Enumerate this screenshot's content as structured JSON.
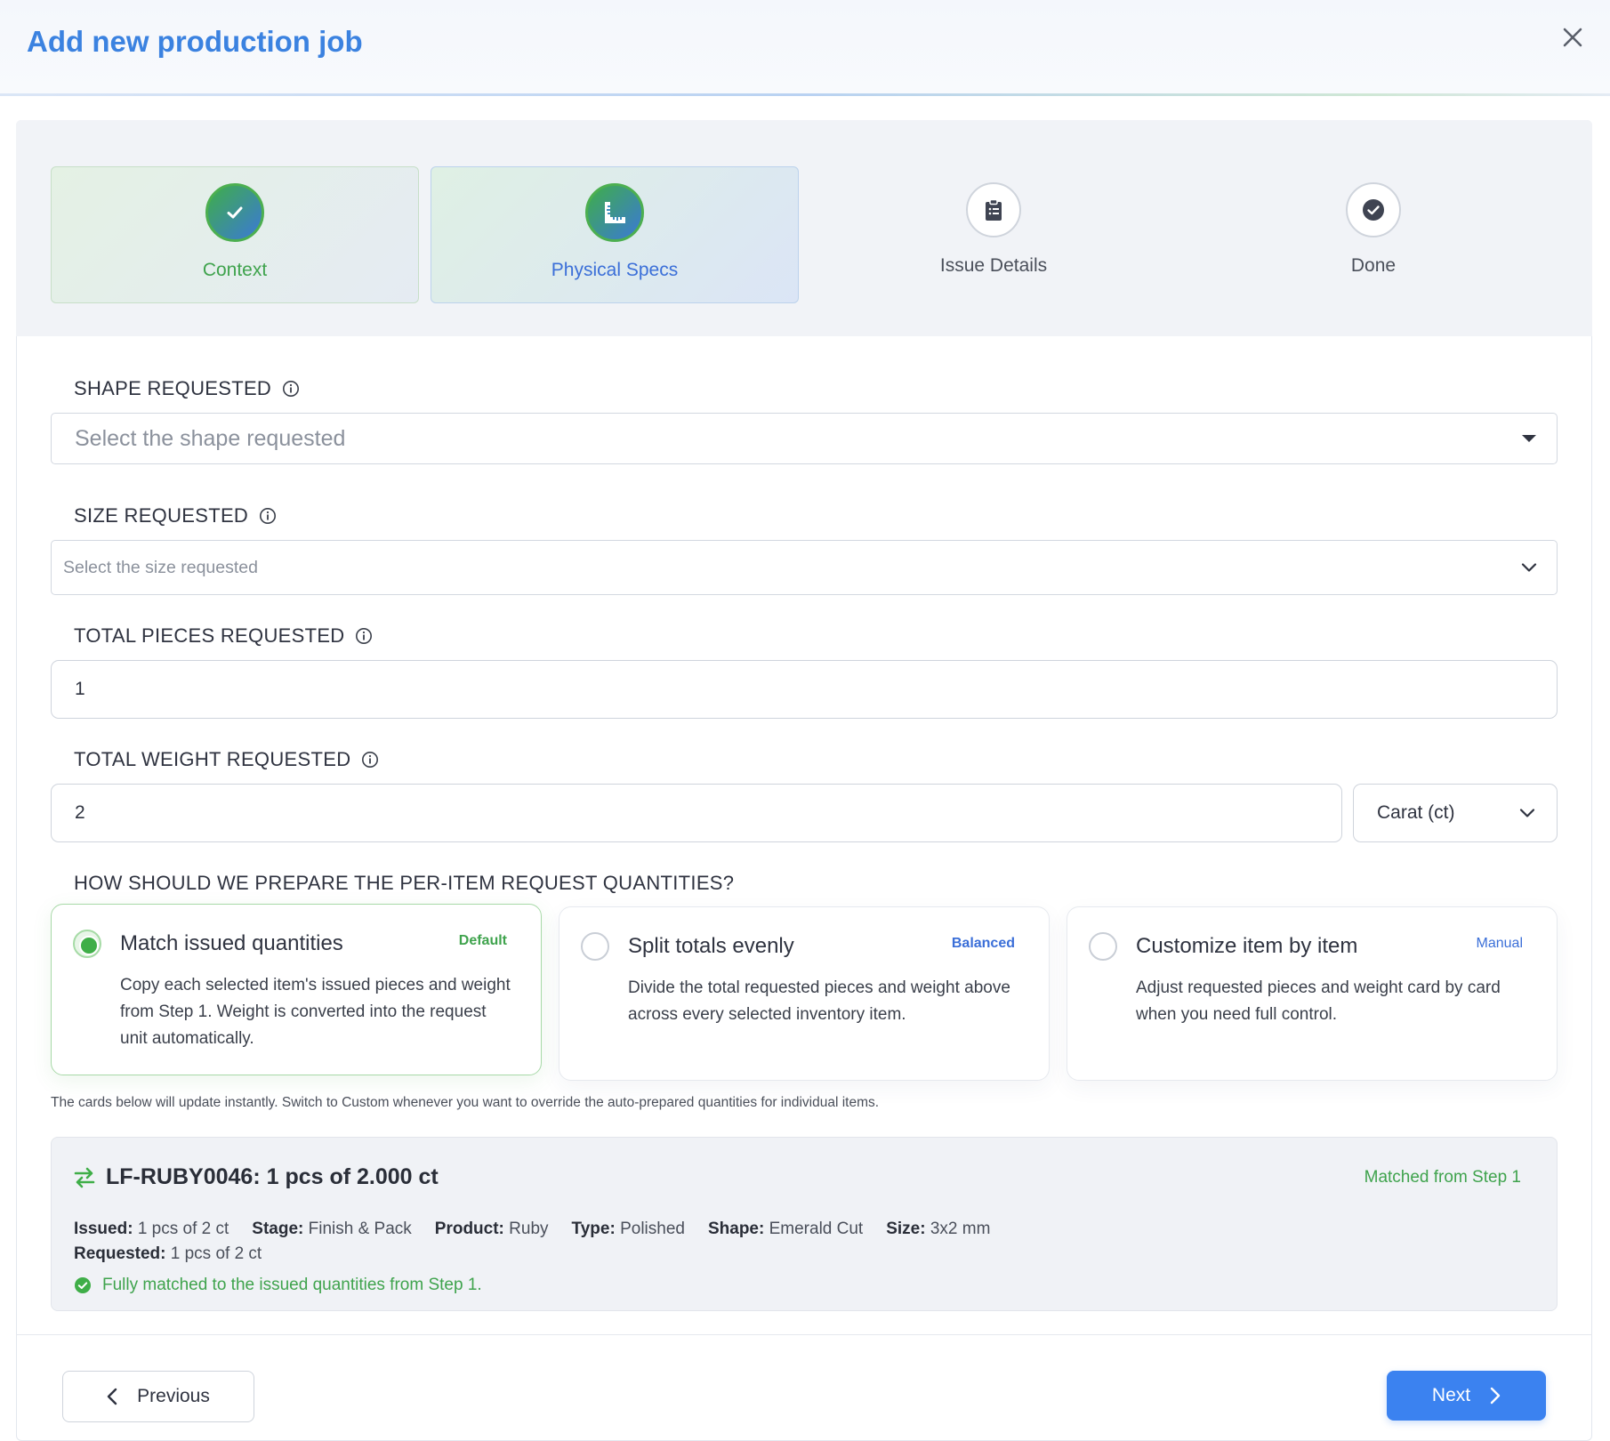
{
  "header": {
    "title": "Add new production job"
  },
  "steps": [
    {
      "label": "Context",
      "state": "completed",
      "icon": "check-icon"
    },
    {
      "label": "Physical Specs",
      "state": "active",
      "icon": "ruler-icon"
    },
    {
      "label": "Issue Details",
      "state": "pending",
      "icon": "clipboard-icon"
    },
    {
      "label": "Done",
      "state": "pending",
      "icon": "check-circle-icon"
    }
  ],
  "shape": {
    "label": "SHAPE REQUESTED",
    "placeholder": "Select the shape requested"
  },
  "size": {
    "label": "SIZE REQUESTED",
    "placeholder": "Select the size requested"
  },
  "pieces": {
    "label": "TOTAL PIECES REQUESTED",
    "value": "1"
  },
  "weight": {
    "label": "TOTAL WEIGHT REQUESTED",
    "value": "2",
    "unit": "Carat (ct)"
  },
  "prepare": {
    "question": "HOW SHOULD WE PREPARE THE PER-ITEM REQUEST QUANTITIES?",
    "options": [
      {
        "title": "Match issued quantities",
        "tag": "Default",
        "description": "Copy each selected item's issued pieces and weight from Step 1. Weight is converted into the request unit automatically.",
        "selected": true
      },
      {
        "title": "Split totals evenly",
        "tag": "Balanced",
        "description": "Divide the total requested pieces and weight above across every selected inventory item.",
        "selected": false
      },
      {
        "title": "Customize item by item",
        "tag": "Manual",
        "description": "Adjust requested pieces and weight card by card when you need full control.",
        "selected": false
      }
    ],
    "hint": "The cards below will update instantly. Switch to Custom whenever you want to override the auto-prepared quantities for individual items."
  },
  "item": {
    "title": "LF-RUBY0046: 1 pcs of 2.000 ct",
    "status": "Matched from Step 1",
    "issued_label": "Issued:",
    "issued": "1 pcs of 2 ct",
    "stage_label": "Stage:",
    "stage": "Finish & Pack",
    "product_label": "Product:",
    "product": "Ruby",
    "type_label": "Type:",
    "type": "Polished",
    "shape_label": "Shape:",
    "shape": "Emerald Cut",
    "size_label": "Size:",
    "size": "3x2 mm",
    "requested_label": "Requested:",
    "requested": "1 pcs of 2 ct",
    "match_message": "Fully matched to the issued quantities from Step 1."
  },
  "footer": {
    "previous_label": "Previous",
    "next_label": "Next"
  },
  "colors": {
    "accent": "#3b82f0",
    "success": "#3fae48",
    "title": "#3b82e0"
  }
}
